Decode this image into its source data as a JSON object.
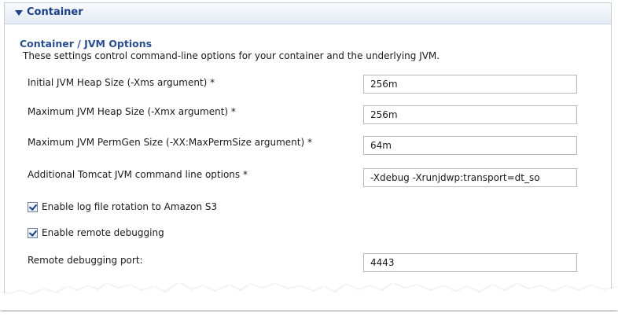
{
  "section": {
    "title": "Container"
  },
  "subsection": {
    "title": "Container / JVM Options",
    "description": "These settings control command-line options for your container and the underlying JVM."
  },
  "fields": [
    {
      "label": "Initial JVM Heap Size (-Xms argument) *",
      "value": "256m"
    },
    {
      "label": "Maximum JVM Heap Size (-Xmx argument) *",
      "value": "256m"
    },
    {
      "label": "Maximum JVM PermGen Size (-XX:MaxPermSize argument) *",
      "value": "64m"
    },
    {
      "label": "Additional Tomcat JVM command line options *",
      "value": "-Xdebug -Xrunjdwp:transport=dt_so"
    }
  ],
  "checkboxes": [
    {
      "label": "Enable log file rotation to Amazon S3",
      "checked": true
    },
    {
      "label": "Enable remote debugging",
      "checked": true
    }
  ],
  "debug_port": {
    "label": "Remote debugging port:",
    "value": "4443"
  },
  "colors": {
    "header_text": "#1b3f87",
    "subsection_text": "#2a4d8f",
    "checkmark": "#1d3d7a"
  }
}
